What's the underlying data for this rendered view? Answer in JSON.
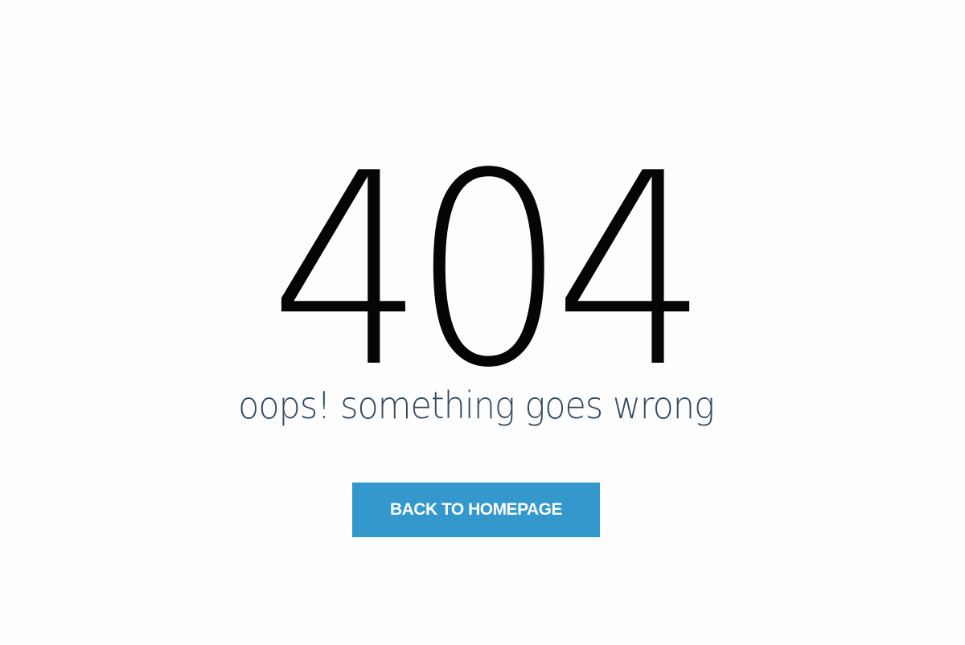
{
  "error": {
    "code": "404",
    "message": "oops! something goes wrong"
  },
  "actions": {
    "back_label": "BACK TO HOMEPAGE"
  },
  "colors": {
    "background": "#fdfdfd",
    "code_text": "#050505",
    "message_text": "#34495e",
    "button_bg": "#3498cc",
    "button_text": "#ffffff"
  }
}
